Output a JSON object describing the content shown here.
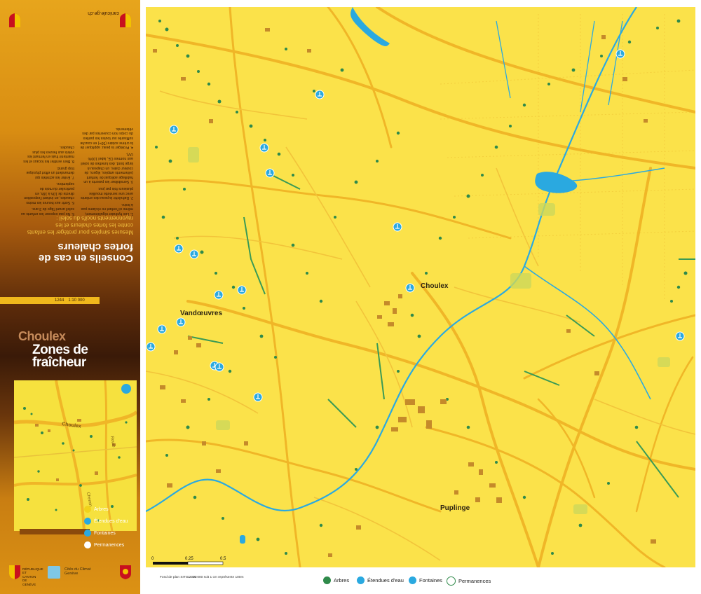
{
  "sidebar": {
    "website": "canicule.ge.ch",
    "advice_title": "Conseils en cas de fortes chaleurs",
    "advice_subtitle": "Mesures simples pour protéger les enfants contre les fortes chaleurs et les rayonnements nocifs du soleil :",
    "advice_items": [
      "1. Les hydrater régulièrement, même si l'enfant ne réclame pas à boire.",
      "2. Rafraîchir la peau des enfants avec une serviette mouillée plusieurs fois par jour.",
      "3. Sensibiliser les parents à un habillage adéquat de l'enfant (vêtements amples, légers, de couleur claire, un chapeau à large bord, des lunettes de soleil aux normes CE, label 100% UV).",
      "4. Protéger la peau: appliquer de la crème solaire (50+) en couche suffisante sur toutes les parties du corps non couvertes par des vêtements.",
      "5. Ne pas exposer les enfants au soleil avant l'âge de 3 ans.",
      "6. Sortir aux heures les moins chaudes, en évitant l'exposition directe de 10h à 16h, en particulier du mois de septembre.",
      "7. Eviter les activités qui demandent un effort physique trop grand.",
      "8. Bien ventiler les locaux et les maintenir frais en fermant les volets aux heures les plus chaudes."
    ],
    "scale_code": "1244",
    "scale_ratio": "1:10 000",
    "commune": "Choulex",
    "title": "Zones de fraîcheur",
    "mini_map": {
      "road_label_1": "Choulex",
      "road_label_2": "Route",
      "road_label_3": "Chemin"
    },
    "mini_legend": [
      "Arbres",
      "Étendues d'eau",
      "Fontaines",
      "Permanences"
    ],
    "logos": {
      "republic_text": "RÉPUBLIQUE ET CANTON DE GENÈVE",
      "climate_title": "Cités du Climat",
      "climate_sub": "Genève"
    }
  },
  "map": {
    "places": [
      "Choulex",
      "Vandœuvres",
      "Puplinge"
    ],
    "scalebar": {
      "zero": "0",
      "mid": "0.25",
      "end": "0.5"
    }
  },
  "footer": {
    "source": "Fond de plan SITG 2023",
    "scale_note": "1 : 10 000 soit 1 cm représente 100m",
    "legend": [
      "Arbres",
      "Étendues d'eau",
      "Fontaines",
      "Permanences"
    ]
  },
  "colors": {
    "map_bg": "#fbe24a",
    "roads": "#f0b627",
    "water": "#2aa9e0",
    "trees": "#2f8a4a",
    "buildings": "#c58a2a",
    "sidebar_dark": "#3a1a08",
    "sidebar_gold": "#e7a51c"
  },
  "icons": [
    "tree-icon",
    "water-icon",
    "fountain-icon",
    "permanence-icon",
    "crest-icon"
  ]
}
